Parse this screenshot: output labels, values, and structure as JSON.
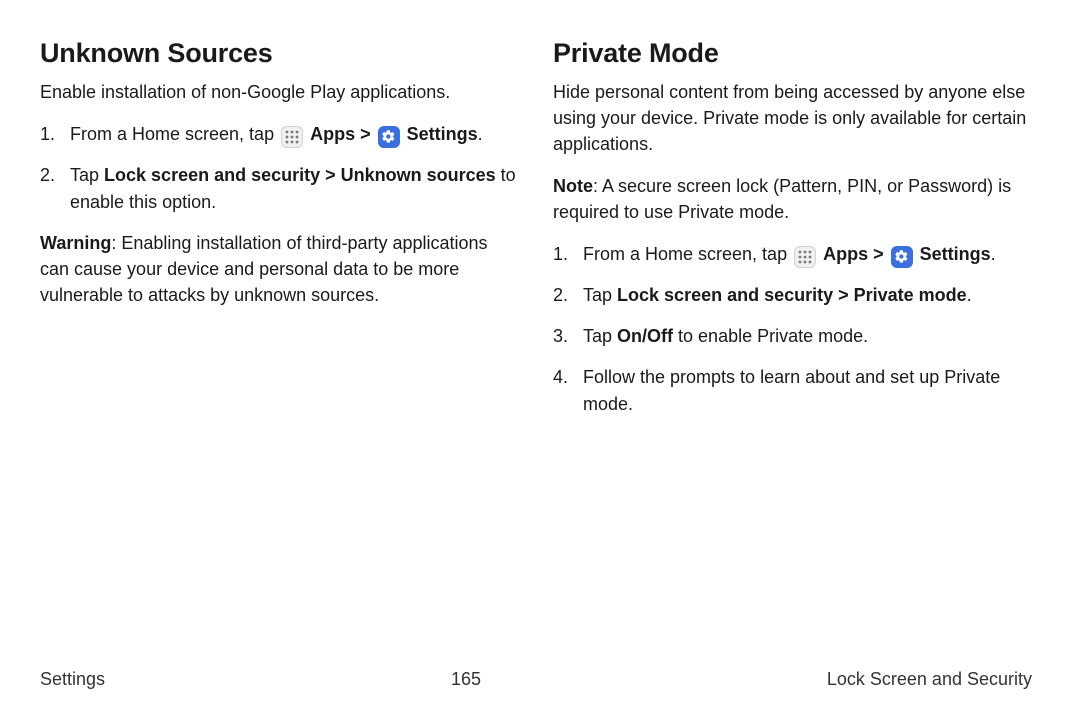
{
  "left": {
    "heading": "Unknown Sources",
    "intro": "Enable installation of non-Google Play applications.",
    "step1_prefix": "From a Home screen, tap ",
    "apps_label": "Apps",
    "settings_label": "Settings",
    "step2_a": "Tap ",
    "step2_bold": "Lock screen and security > Unknown sources",
    "step2_b": " to enable this option.",
    "warning_label": "Warning",
    "warning_body": ": Enabling installation of third-party applications can cause your device and personal data to be more vulnerable to attacks by unknown sources."
  },
  "right": {
    "heading": "Private Mode",
    "intro": "Hide personal content from being accessed by anyone else using your device. Private mode is only available for certain applications.",
    "note_label": "Note",
    "note_body": ": A secure screen lock (Pattern, PIN, or Password) is required to use Private mode.",
    "step1_prefix": "From a Home screen, tap ",
    "apps_label": "Apps",
    "settings_label": "Settings",
    "step2_a": "Tap ",
    "step2_bold": "Lock screen and security > Private mode",
    "step2_b": ".",
    "step3_a": "Tap ",
    "step3_bold": "On/Off",
    "step3_b": " to enable Private mode.",
    "step4": "Follow the prompts to learn about and set up Private mode."
  },
  "footer": {
    "left": "Settings",
    "center": "165",
    "right": "Lock Screen and Security"
  },
  "glyphs": {
    "sep": " > "
  }
}
